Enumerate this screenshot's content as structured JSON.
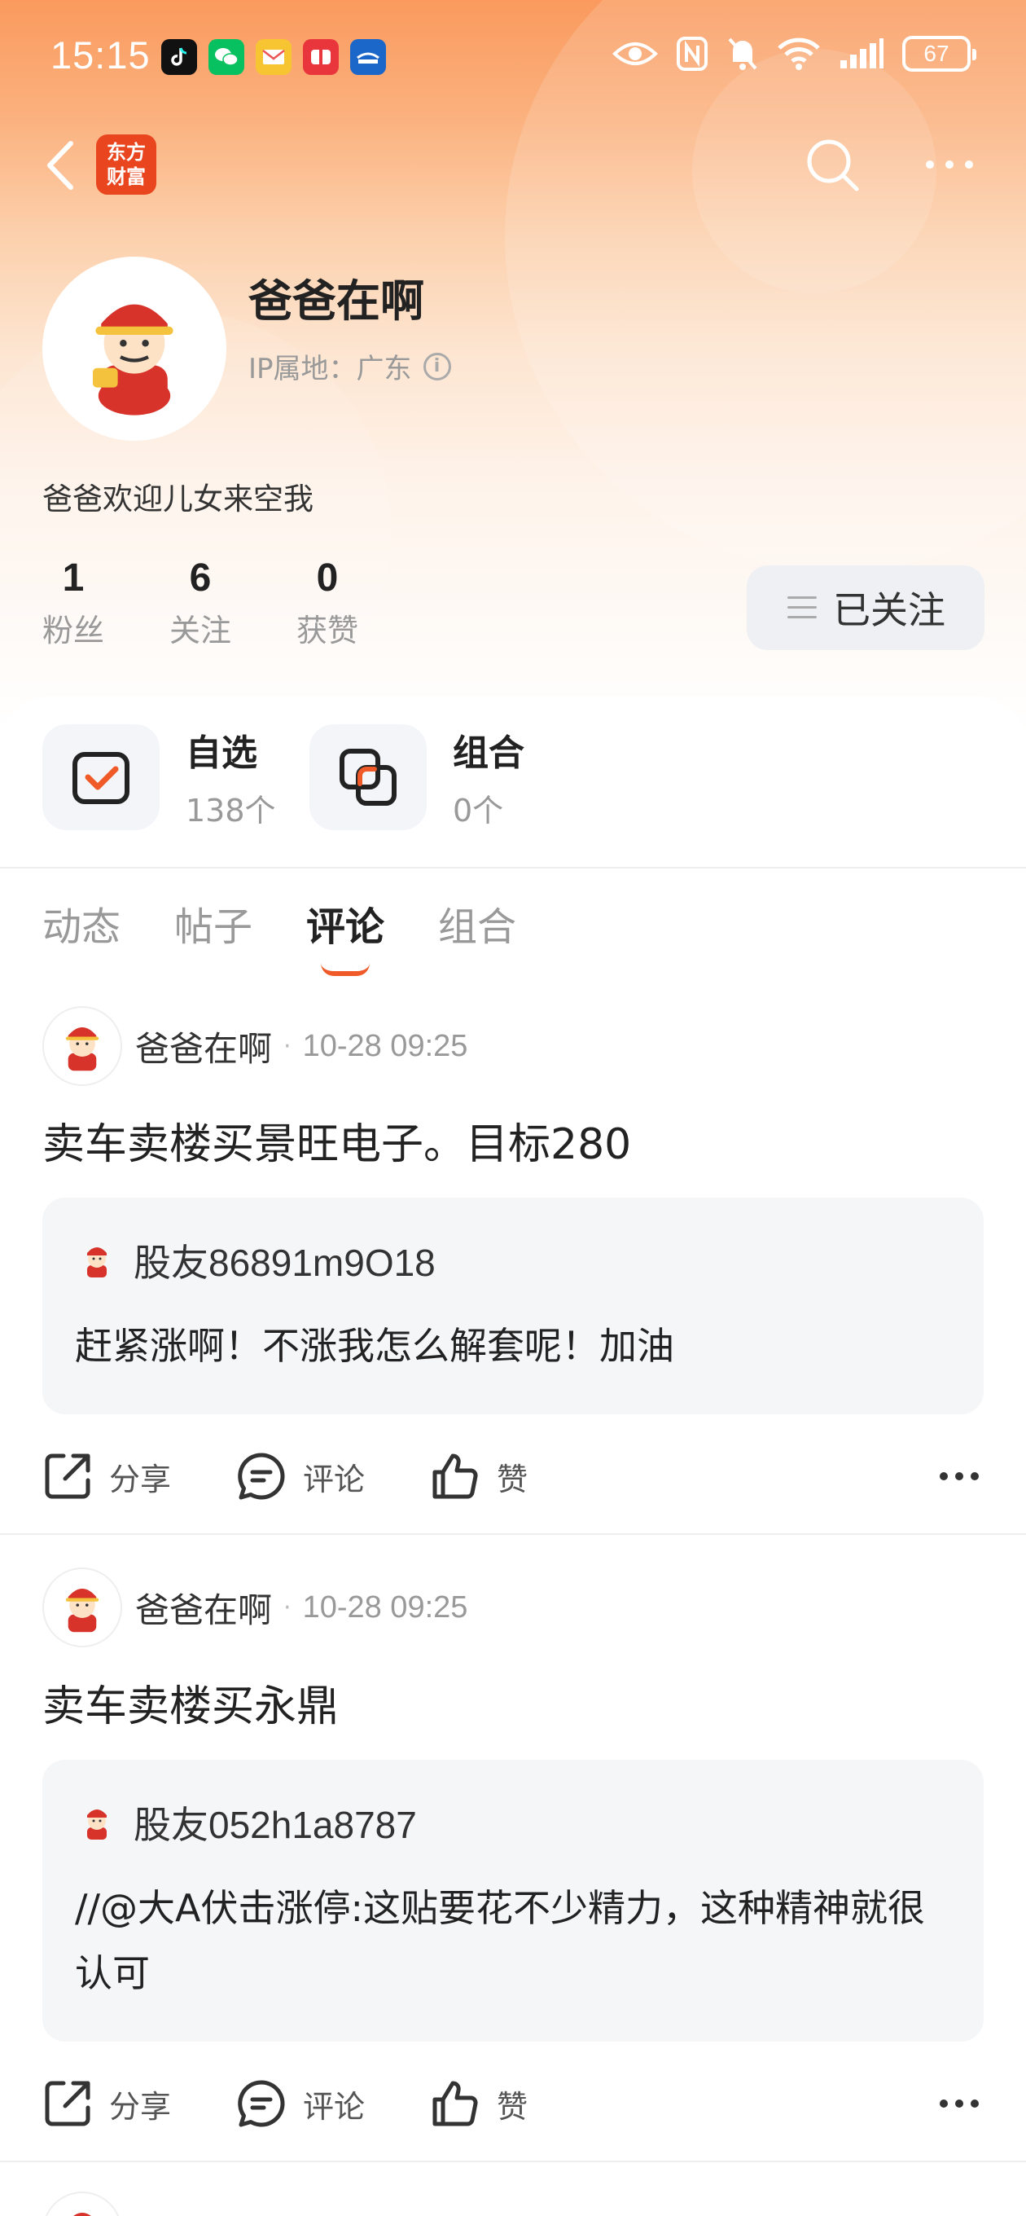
{
  "status_bar": {
    "time": "15:15",
    "battery": "67",
    "notification_icons": [
      "tiktok-icon",
      "wechat-icon",
      "mail-icon",
      "red-app-icon",
      "blue-app-icon"
    ],
    "system_icons": [
      "eye-icon",
      "nfc-icon",
      "mute-icon",
      "wifi-icon",
      "signal-icon"
    ]
  },
  "nav": {
    "app_logo": [
      "东方",
      "财富"
    ]
  },
  "profile": {
    "username": "爸爸在啊",
    "ip_location": "IP属地：广东",
    "bio": "爸爸欢迎儿女来空我",
    "stats": [
      {
        "value": "1",
        "label": "粉丝"
      },
      {
        "value": "6",
        "label": "关注"
      },
      {
        "value": "0",
        "label": "获赞"
      }
    ],
    "follow_label": "已关注"
  },
  "quick": [
    {
      "title": "自选",
      "sub": "138个"
    },
    {
      "title": "组合",
      "sub": "0个"
    }
  ],
  "tabs": [
    {
      "label": "动态",
      "active": false
    },
    {
      "label": "帖子",
      "active": false
    },
    {
      "label": "评论",
      "active": true
    },
    {
      "label": "组合",
      "active": false
    }
  ],
  "posts": [
    {
      "author": "爸爸在啊",
      "time": "10-28 09:25",
      "text": "卖车卖楼买景旺电子。目标280",
      "quote_user": "股友86891m9O18",
      "quote_text": "赶紧涨啊！不涨我怎么解套呢！加油"
    },
    {
      "author": "爸爸在啊",
      "time": "10-28 09:25",
      "text": "卖车卖楼买永鼎",
      "quote_user": "股友052h1a8787",
      "quote_text": "//@大A伏击涨停:这贴要花不少精力，这种精神就很认可"
    }
  ],
  "actions": {
    "share": "分享",
    "comment": "评论",
    "like": "赞"
  },
  "colors": {
    "accent": "#f05a28",
    "header_top": "#fa9a5e",
    "logo_bg": "#e9461f"
  }
}
